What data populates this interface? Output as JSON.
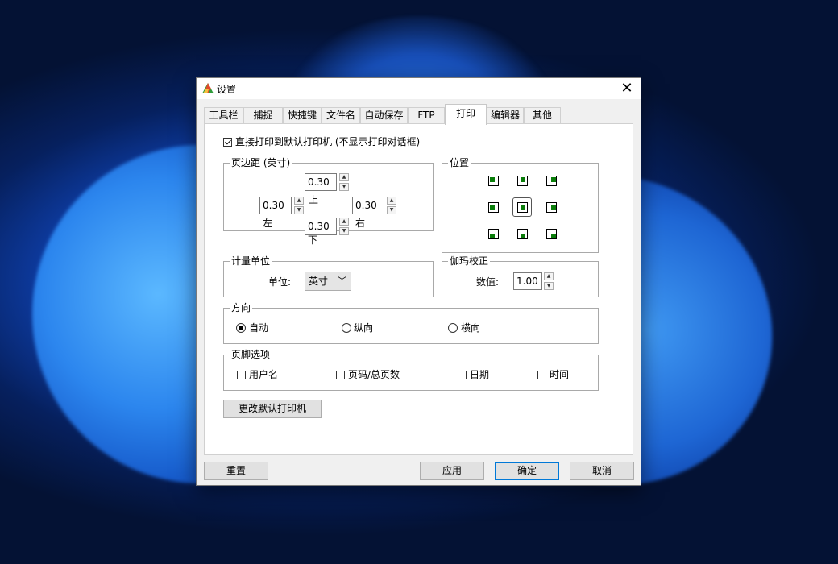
{
  "window": {
    "title": "设置",
    "close_glyph": "✕"
  },
  "tabs": [
    "工具栏",
    "捕捉",
    "快捷键",
    "文件名",
    "自动保存",
    "FTP",
    "打印",
    "编辑器",
    "其他"
  ],
  "active_tab": "打印",
  "direct_print": {
    "label": "直接打印到默认打印机 (不显示打印对话框)",
    "checked": true
  },
  "margins": {
    "title": "页边距 (英寸)",
    "top": {
      "value": "0.30",
      "label": "上"
    },
    "left": {
      "value": "0.30",
      "label": "左"
    },
    "right": {
      "value": "0.30",
      "label": "右"
    },
    "bottom": {
      "value": "0.30",
      "label": "下"
    }
  },
  "position": {
    "title": "位置",
    "selected": "middle-center"
  },
  "units": {
    "title": "计量单位",
    "label": "单位:",
    "value": "英寸"
  },
  "gamma": {
    "title": "伽玛校正",
    "label": "数值:",
    "value": "1.00"
  },
  "orientation": {
    "title": "方向",
    "options": [
      {
        "label": "自动",
        "checked": true
      },
      {
        "label": "纵向",
        "checked": false
      },
      {
        "label": "横向",
        "checked": false
      }
    ]
  },
  "footer": {
    "title": "页脚选项",
    "options": [
      {
        "label": "用户名",
        "checked": false
      },
      {
        "label": "页码/总页数",
        "checked": false
      },
      {
        "label": "日期",
        "checked": false
      },
      {
        "label": "时间",
        "checked": false
      }
    ]
  },
  "buttons": {
    "change_printer": "更改默认打印机",
    "reset": "重置",
    "apply": "应用",
    "ok": "确定",
    "cancel": "取消"
  },
  "colors": {
    "accent": "#0078d7",
    "position_marker": "#0a7d0a"
  }
}
